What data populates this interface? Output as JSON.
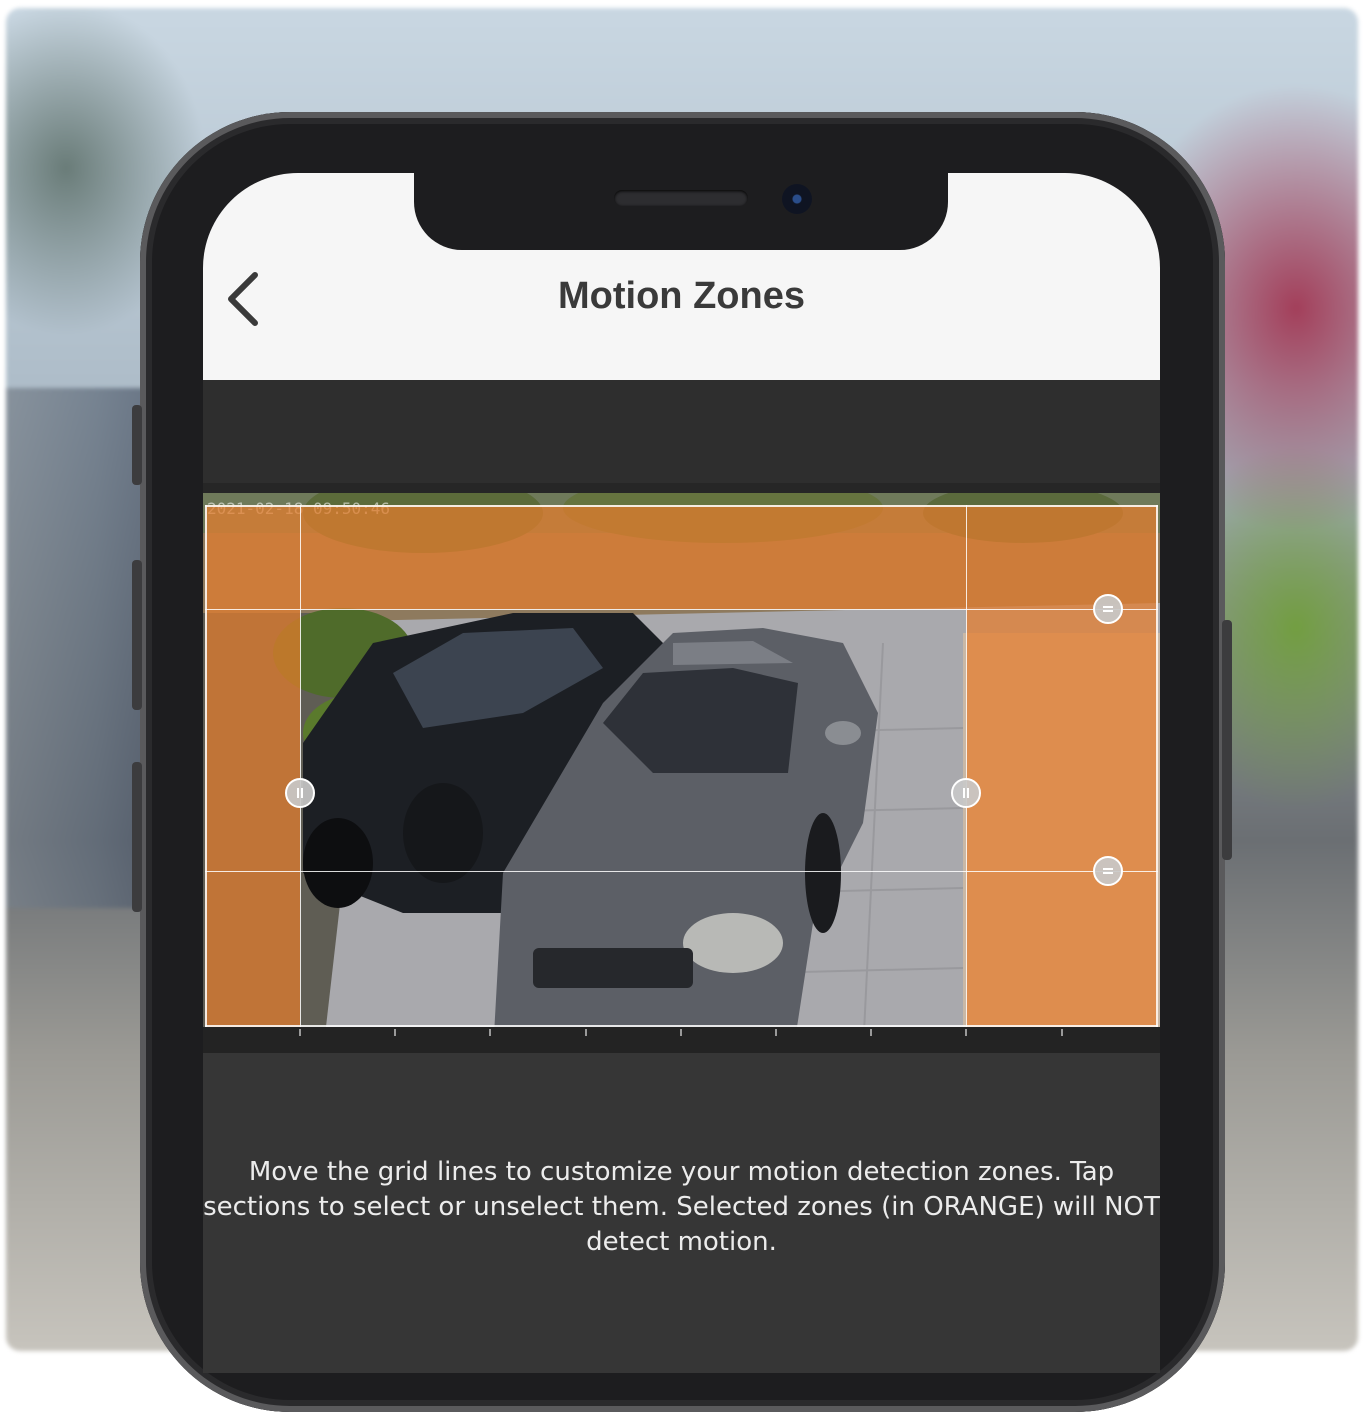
{
  "header": {
    "title": "Motion Zones",
    "back_icon": "chevron-left-icon"
  },
  "camera": {
    "timestamp": "2021-02-18 09:50:46"
  },
  "grid": {
    "rows": 3,
    "cols": 3,
    "selected_color": "#e67d2d",
    "zones": [
      {
        "id": "r1c1",
        "selected": true
      },
      {
        "id": "r1c2",
        "selected": true
      },
      {
        "id": "r1c3",
        "selected": true
      },
      {
        "id": "r2c1",
        "selected": true
      },
      {
        "id": "r2c2",
        "selected": false
      },
      {
        "id": "r2c3",
        "selected": true
      },
      {
        "id": "r3c1",
        "selected": true
      },
      {
        "id": "r3c2",
        "selected": false
      },
      {
        "id": "r3c3",
        "selected": true
      }
    ]
  },
  "instructions": "Move the grid lines to customize your motion detection zones. Tap sections to select or unselect them. Selected zones (in ORANGE) will NOT detect motion."
}
